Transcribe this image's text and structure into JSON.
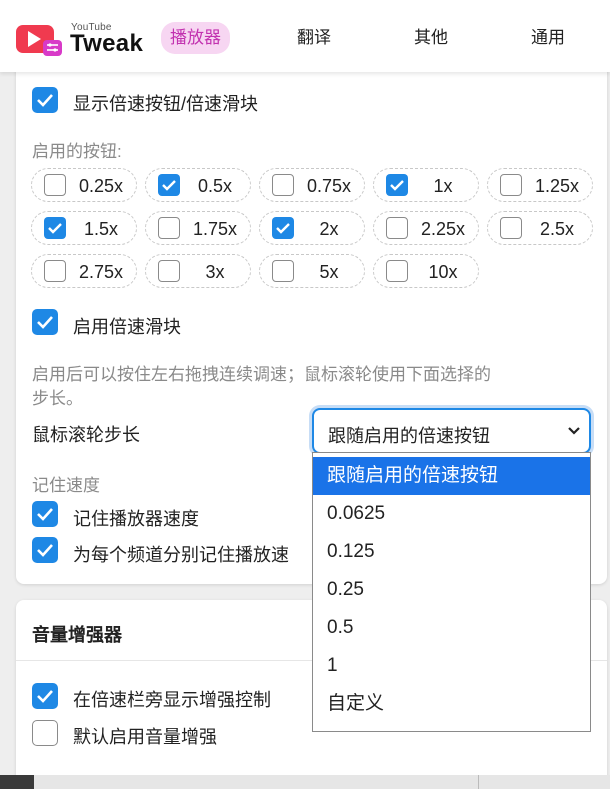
{
  "header": {
    "brand_small": "YouTube",
    "brand_big": "Tweak",
    "tabs": [
      "播放器",
      "翻译",
      "其他",
      "通用"
    ]
  },
  "speed": {
    "show_controls_label": "显示倍速按钮/倍速滑块",
    "enabled_buttons_title": "启用的按钮:",
    "buttons": [
      {
        "label": "0.25x",
        "checked": false
      },
      {
        "label": "0.5x",
        "checked": true
      },
      {
        "label": "0.75x",
        "checked": false
      },
      {
        "label": "1x",
        "checked": true
      },
      {
        "label": "1.25x",
        "checked": false
      },
      {
        "label": "1.5x",
        "checked": true
      },
      {
        "label": "1.75x",
        "checked": false
      },
      {
        "label": "2x",
        "checked": true
      },
      {
        "label": "2.25x",
        "checked": false
      },
      {
        "label": "2.5x",
        "checked": false
      },
      {
        "label": "2.75x",
        "checked": false
      },
      {
        "label": "3x",
        "checked": false
      },
      {
        "label": "5x",
        "checked": false
      },
      {
        "label": "10x",
        "checked": false
      }
    ],
    "slider_label": "启用倍速滑块",
    "slider_hint_line1": "启用后可以按住左右拖拽连续调速；鼠标滚轮使用下面选择的",
    "slider_hint_line2": "步长。",
    "wheel_step_label": "鼠标滚轮步长",
    "wheel_step_value": "跟随启用的倍速按钮",
    "wheel_step_options": [
      "跟随启用的倍速按钮",
      "0.0625",
      "0.125",
      "0.25",
      "0.5",
      "1",
      "自定义"
    ],
    "remember_title": "记住速度",
    "remember_player_label": "记住播放器速度",
    "remember_channel_label": "为每个频道分别记住播放速"
  },
  "volume": {
    "title": "音量增强器",
    "show_booster_label": "在倍速栏旁显示增强控制",
    "default_booster_label": "默认启用音量增强"
  },
  "colors": {
    "accent": "#1e88e5",
    "tab_active_bg": "#f7d6f2",
    "tab_active_fg": "#c233b0",
    "logo_red": "#f03a4f",
    "logo_pink": "#d83ac8"
  }
}
